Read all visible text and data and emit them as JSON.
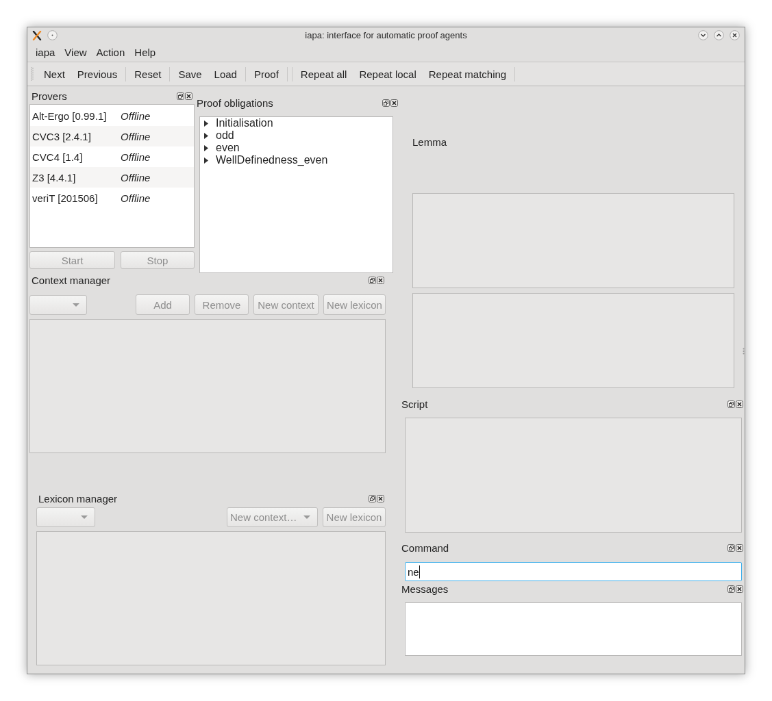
{
  "window": {
    "title": "iapa: interface for automatic proof agents"
  },
  "menu_bar": [
    {
      "label": "iapa"
    },
    {
      "label": "View"
    },
    {
      "label": "Action"
    },
    {
      "label": "Help"
    }
  ],
  "toolbar": [
    {
      "kind": "button",
      "label": "Next"
    },
    {
      "kind": "button",
      "label": "Previous"
    },
    {
      "kind": "separator"
    },
    {
      "kind": "button",
      "label": "Reset"
    },
    {
      "kind": "separator"
    },
    {
      "kind": "button",
      "label": "Save"
    },
    {
      "kind": "button",
      "label": "Load"
    },
    {
      "kind": "separator"
    },
    {
      "kind": "button",
      "label": "Proof"
    },
    {
      "kind": "separator"
    },
    {
      "kind": "separator"
    },
    {
      "kind": "button",
      "label": "Repeat all"
    },
    {
      "kind": "button",
      "label": "Repeat local"
    },
    {
      "kind": "button",
      "label": "Repeat matching"
    },
    {
      "kind": "separator"
    }
  ],
  "provers": {
    "title": "Provers",
    "rows": [
      {
        "name": "Alt-Ergo [0.99.1]",
        "status": "Offline"
      },
      {
        "name": "CVC3 [2.4.1]",
        "status": "Offline"
      },
      {
        "name": "CVC4 [1.4]",
        "status": "Offline"
      },
      {
        "name": "Z3 [4.4.1]",
        "status": "Offline"
      },
      {
        "name": "veriT [201506]",
        "status": "Offline"
      }
    ],
    "buttons": [
      {
        "label": "Start",
        "disabled": true
      },
      {
        "label": "Stop",
        "disabled": true
      }
    ]
  },
  "proof_obligations": {
    "title": "Proof obligations",
    "items": [
      {
        "label": "Initialisation",
        "expanded": false
      },
      {
        "label": "odd",
        "expanded": false
      },
      {
        "label": "even",
        "expanded": false
      },
      {
        "label": "WellDefinedness_even",
        "expanded": false
      }
    ]
  },
  "context_manager": {
    "title": "Context manager",
    "buttons": [
      {
        "label": "Add",
        "disabled": true
      },
      {
        "label": "Remove",
        "disabled": true
      },
      {
        "label": "New context",
        "disabled": true
      },
      {
        "label": "New lexicon",
        "disabled": true
      }
    ],
    "list": {
      "disabled": true
    }
  },
  "lexicon_manager": {
    "title": "Lexicon manager",
    "context_select": {
      "value": "New context…",
      "disabled": true
    },
    "buttons": [
      {
        "label": "New lexicon",
        "disabled": true
      }
    ],
    "list": {
      "disabled": true
    }
  },
  "lemma": {
    "title": "Lemma",
    "panes": [
      {
        "disabled": true
      },
      {
        "disabled": true
      }
    ]
  },
  "script": {
    "title": "Script",
    "disabled": true
  },
  "command": {
    "title": "Command",
    "value": "ne",
    "focused": true
  },
  "messages": {
    "title": "Messages",
    "disabled": false
  }
}
